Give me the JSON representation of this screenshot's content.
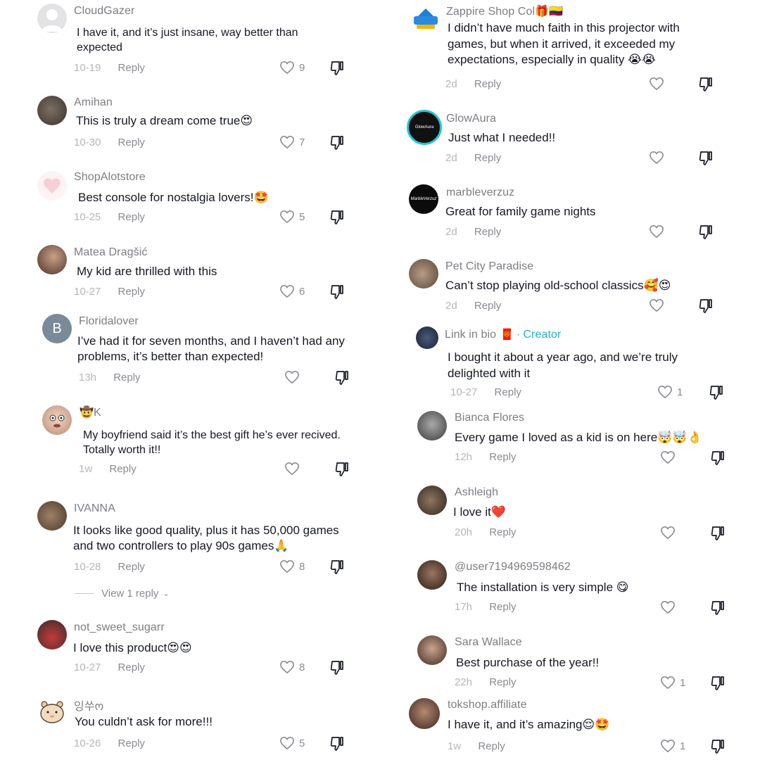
{
  "left": {
    "comments": [
      {
        "username": "CloudGazer",
        "text": "I have it, and it’s just insane, way better than expected",
        "date": "10-19",
        "reply": "Reply",
        "likes": "9",
        "avatar": "gray-silhouette"
      },
      {
        "username": "Amihan",
        "text": "This is truly a dream come true😍",
        "date": "10-30",
        "reply": "Reply",
        "likes": "7",
        "avatar": "photo-cat"
      },
      {
        "username": "ShopAlotstore",
        "text": "Best console for nostalgia lovers!🤩",
        "date": "10-25",
        "reply": "Reply",
        "likes": "5",
        "avatar": "pink-heart-logo"
      },
      {
        "username": "Matea Dragšić",
        "text": "My kid are thrilled with this",
        "date": "10-27",
        "reply": "Reply",
        "likes": "6",
        "avatar": "photo-woman"
      },
      {
        "username": "Floridalover",
        "text": "I’ve had it for seven months, and I haven’t had any problems, it’s better than expected!",
        "date": "13h",
        "reply": "Reply",
        "likes": "",
        "avatar": "letter-B",
        "avatar_letter": "B"
      },
      {
        "username": "🤠K",
        "text": "My boyfriend said it’s the best gift he’s ever recived. Totally worth it!!",
        "date": "1w",
        "reply": "Reply",
        "likes": "",
        "avatar": "cartoon-face"
      },
      {
        "username": "IVANNA",
        "text": "It looks like good quality, plus it has 50,000 games and two controllers to play 90s games🙏",
        "date": "10-28",
        "reply": "Reply",
        "likes": "8",
        "avatar": "photo-brown"
      },
      {
        "username": "not_sweet_sugarr",
        "text": "I love this product😍😍",
        "date": "10-27",
        "reply": "Reply",
        "likes": "8",
        "avatar": "photo-red"
      },
      {
        "username": "잉쑤ო",
        "text": "You culdn’t ask for more!!!",
        "date": "10-26",
        "reply": "Reply",
        "likes": "5",
        "avatar": "hamster-icon"
      }
    ],
    "view_replies": "View 1 reply"
  },
  "right": {
    "comments": [
      {
        "username": "Zappire Shop Col🎁🇨🇴",
        "text": "I didn’t have much faith in this projector with games, but when it arrived, it exceeded my expectations, especially in quality 😭😭",
        "date": "2d",
        "reply": "Reply",
        "likes": "",
        "avatar": "mega-logo"
      },
      {
        "username": "GlowAura",
        "text": "Just what I needed!!",
        "date": "2d",
        "reply": "Reply",
        "likes": "",
        "avatar": "glowaura-logo",
        "avatar_text": "GlowAura"
      },
      {
        "username": "marbleverzuz",
        "text": "Great for family game nights",
        "date": "2d",
        "reply": "Reply",
        "likes": "",
        "avatar": "marble-logo",
        "avatar_text": "MarbleVerzuz"
      },
      {
        "username": "Pet City Paradise",
        "text": "Can’t stop playing old-school classics🥰😍",
        "date": "2d",
        "reply": "Reply",
        "likes": "",
        "avatar": "photo-dogs"
      },
      {
        "username": "Link in bio",
        "badge": "🧧",
        "dot": "·",
        "creator": "Creator",
        "text": "I bought it about a year ago, and we’re truly delighted with it",
        "date": "10-27",
        "reply": "Reply",
        "likes": "1",
        "avatar": "photo-dark"
      },
      {
        "username": "Bianca Flores",
        "text": "Every game I loved as a kid is on here🤯🤯👌",
        "date": "12h",
        "reply": "Reply",
        "likes": "",
        "avatar": "photo-woman-bw"
      },
      {
        "username": "Ashleigh",
        "text": "I love it❤️",
        "date": "20h",
        "reply": "Reply",
        "likes": "",
        "avatar": "photo-couple"
      },
      {
        "username": "@user7194969598462",
        "text": "The installation is very simple 😋",
        "date": "17h",
        "reply": "Reply",
        "likes": "",
        "avatar": "photo-woman-dark"
      },
      {
        "username": "Sara Wallace",
        "text": "Best purchase of the year!!",
        "date": "22h",
        "reply": "Reply",
        "likes": "1",
        "avatar": "photo-woman-smile"
      },
      {
        "username": "tokshop.affiliate",
        "text": "I have it, and it’s amazing😌🤩",
        "date": "1w",
        "reply": "Reply",
        "likes": "1",
        "avatar": "photo-woman-curly"
      }
    ]
  }
}
